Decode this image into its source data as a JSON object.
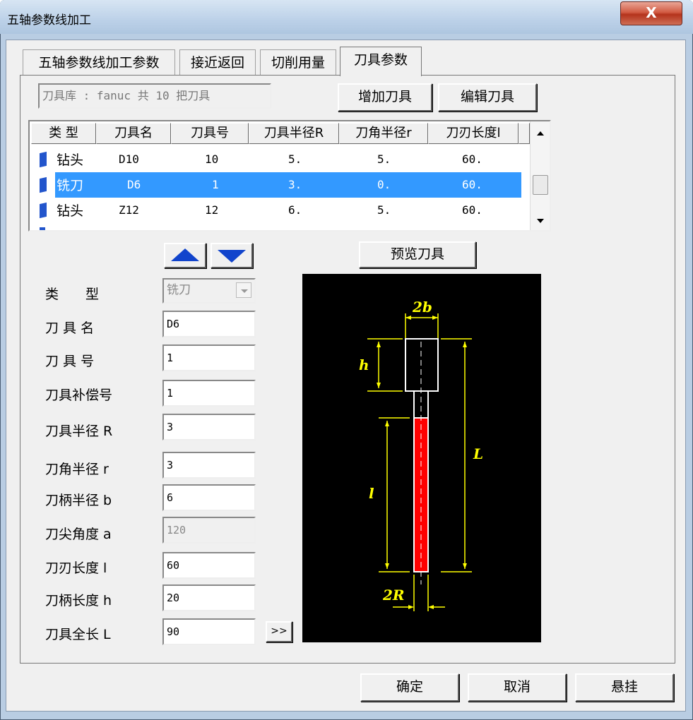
{
  "window": {
    "title": "五轴参数线加工",
    "close_label": "X"
  },
  "tabs": [
    {
      "label": "五轴参数线加工参数"
    },
    {
      "label": "接近返回"
    },
    {
      "label": "切削用量"
    },
    {
      "label": "刀具参数",
      "active": true
    }
  ],
  "library": {
    "text": "刀具库 : fanuc  共 10 把刀具"
  },
  "buttons": {
    "add_tool": "增加刀具",
    "edit_tool": "编辑刀具",
    "preview": "预览刀具",
    "more": ">>",
    "ok": "确定",
    "cancel": "取消",
    "hang": "悬挂"
  },
  "table": {
    "columns": [
      "类 型",
      "刀具名",
      "刀具号",
      "刀具半径R",
      "刀角半径r",
      "刀刃长度l"
    ],
    "rows": [
      {
        "type": "钻头",
        "name": "D10",
        "number": "10",
        "radius": "5.",
        "corner": "5.",
        "length": "60.",
        "selected": false
      },
      {
        "type": "铣刀",
        "name": "D6",
        "number": "1",
        "radius": "3.",
        "corner": "0.",
        "length": "60.",
        "selected": true
      },
      {
        "type": "钻头",
        "name": "Z12",
        "number": "12",
        "radius": "6.",
        "corner": "5.",
        "length": "60.",
        "selected": false
      }
    ]
  },
  "form": {
    "type_label": "类　　型",
    "type_value": "铣刀",
    "name_label": "刀 具 名",
    "name_value": "D6",
    "number_label": "刀 具 号",
    "number_value": "1",
    "comp_label": "刀具补偿号",
    "comp_value": "1",
    "radius_label": "刀具半径 R",
    "radius_value": "3",
    "corner_label": "刀角半径 r",
    "corner_value": "3",
    "shank_radius_label": "刀柄半径 b",
    "shank_radius_value": "6",
    "tip_angle_label": "刀尖角度 a",
    "tip_angle_value": "120",
    "edge_length_label": "刀刃长度 l",
    "edge_length_value": "60",
    "shank_length_label": "刀柄长度 h",
    "shank_length_value": "20",
    "total_length_label": "刀具全长 L",
    "total_length_value": "90"
  },
  "diagram": {
    "label_2b": "2b",
    "label_h": "h",
    "label_L": "L",
    "label_l": "l",
    "label_2R": "2R"
  },
  "colors": {
    "selection": "#3399ff",
    "dimension": "#ffff00",
    "cutter": "#ff0000"
  }
}
